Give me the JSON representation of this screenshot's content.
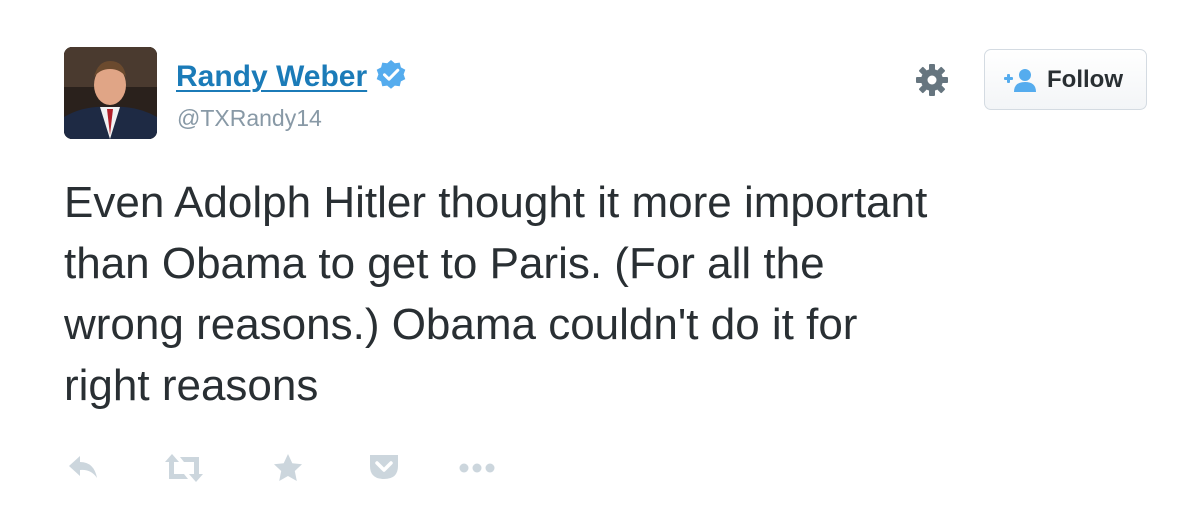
{
  "author": {
    "display_name": "Randy Weber",
    "handle": "@TXRandy14",
    "verified": true
  },
  "header": {
    "settings_icon": "gear-icon",
    "follow_label": "Follow",
    "follow_icon": "add-user-icon"
  },
  "tweet": {
    "lines": [
      "Even Adolph Hitler thought it more important",
      "than Obama to get to Paris. (For all the",
      "wrong reasons.) Obama couldn't do it for",
      "right reasons"
    ]
  },
  "actions": [
    {
      "icon": "reply-icon"
    },
    {
      "icon": "retweet-icon"
    },
    {
      "icon": "favorite-star-icon"
    },
    {
      "icon": "pocket-icon"
    },
    {
      "icon": "more-dots-icon"
    }
  ],
  "colors": {
    "name_link": "#1b7bb8",
    "verified": "#55acee",
    "muted": "#8899a6",
    "text": "#292f33",
    "action_icons": "#ccd6dd"
  }
}
